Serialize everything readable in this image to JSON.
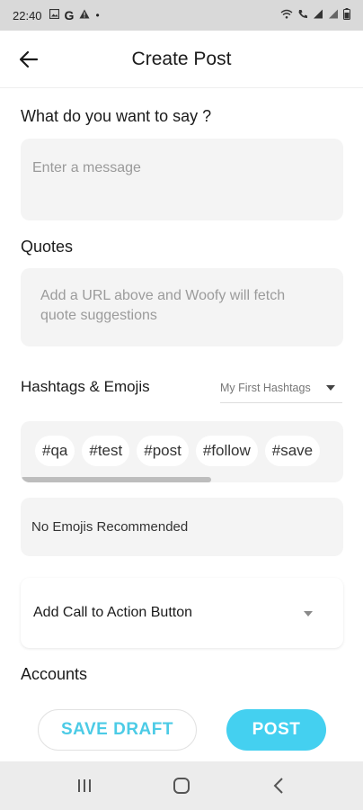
{
  "status_bar": {
    "time": "22:40",
    "icons": [
      "gallery-icon",
      "google-icon",
      "warning-icon",
      "dot-icon"
    ],
    "right_icons": [
      "wifi-icon",
      "call-icon",
      "signal-icon",
      "signal-icon",
      "battery-icon"
    ]
  },
  "header": {
    "title": "Create Post",
    "back_icon": "arrow-left-icon"
  },
  "message": {
    "label": "What do you want to say ?",
    "placeholder": "Enter a message",
    "value": ""
  },
  "quotes": {
    "label": "Quotes",
    "hint": "Add a URL above and Woofy will fetch quote suggestions"
  },
  "hashtags": {
    "label": "Hashtags & Emojis",
    "selected_set": "My First Hashtags",
    "chips": [
      "#qa",
      "#test",
      "#post",
      "#follow",
      "#save"
    ],
    "scroll_fraction": 0.59
  },
  "emojis": {
    "text": "No Emojis Recommended"
  },
  "cta": {
    "label": "Add Call to Action Button"
  },
  "accounts": {
    "label": "Accounts"
  },
  "actions": {
    "save_draft": "SAVE DRAFT",
    "post": "POST"
  },
  "colors": {
    "accent": "#44d0f0",
    "accent_text": "#4ccbe6",
    "field_bg": "#f4f4f4",
    "status_bar_bg": "#d9d9d9",
    "nav_bar_bg": "#ececec"
  }
}
